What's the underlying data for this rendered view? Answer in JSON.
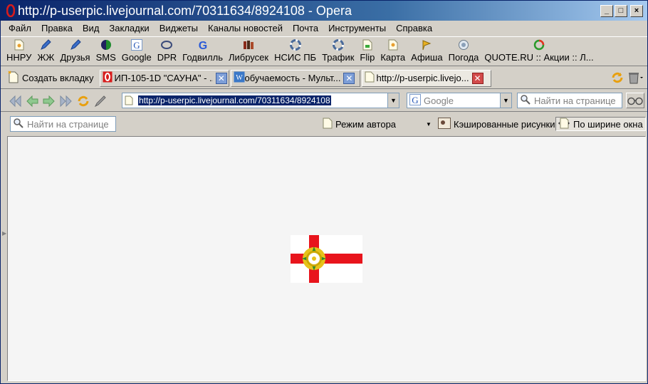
{
  "window": {
    "title": "http://p-userpic.livejournal.com/70311634/8924108 - Opera",
    "buttons": {
      "minimize": "_",
      "maximize": "□",
      "close": "×"
    }
  },
  "menu": {
    "items": [
      "Файл",
      "Правка",
      "Вид",
      "Закладки",
      "Виджеты",
      "Каналы новостей",
      "Почта",
      "Инструменты",
      "Справка"
    ]
  },
  "personal_bar": {
    "items": [
      {
        "label": "ННРУ",
        "icon": "page-icon"
      },
      {
        "label": "ЖЖ",
        "icon": "pencil-icon"
      },
      {
        "label": "Друзья",
        "icon": "pencil-icon"
      },
      {
        "label": "SMS",
        "icon": "sms-icon"
      },
      {
        "label": "Google",
        "icon": "google-icon"
      },
      {
        "label": "DPR",
        "icon": "dpr-icon"
      },
      {
        "label": "Годвилль",
        "icon": "google-icon"
      },
      {
        "label": "Либрусек",
        "icon": "books-icon"
      },
      {
        "label": "НСИС ПБ",
        "icon": "lifebuoy-icon"
      },
      {
        "label": "Трафик",
        "icon": "lifebuoy-icon"
      },
      {
        "label": "Flip",
        "icon": "page-icon"
      },
      {
        "label": "Карта",
        "icon": "page-icon"
      },
      {
        "label": "Афиша",
        "icon": "star-icon"
      },
      {
        "label": "Погода",
        "icon": "weather-icon"
      },
      {
        "label": "QUOTE.RU :: Акции :: Л...",
        "icon": "quote-icon"
      }
    ]
  },
  "tabs": {
    "new_tab_label": "Создать вкладку",
    "items": [
      {
        "title": "ИП-105-1D \"САУНА\" - ...",
        "icon": "opera-icon",
        "active": false
      },
      {
        "title": "обучаемость - Мульт...",
        "icon": "wiki-icon",
        "active": false
      },
      {
        "title": "http://p-userpic.livejo...",
        "icon": "page-icon",
        "active": true
      }
    ]
  },
  "address_bar": {
    "url": "http://p-userpic.livejournal.com/70311634/8924108",
    "search_engine": "Google",
    "find_placeholder": "Найти на странице"
  },
  "view_bar": {
    "find_placeholder": "Найти на странице",
    "author_mode": "Режим автора",
    "cached_images": "Кэшированные рисунки",
    "fit_width": "По ширине окна"
  },
  "content": {
    "image_desc_colors": {
      "cross": "#e8141c",
      "field": "#ffffff",
      "rose_center": "#ffffff",
      "rose_ring": "#c9a400"
    }
  }
}
